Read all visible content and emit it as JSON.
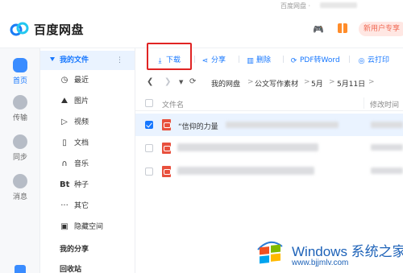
{
  "window": {
    "title": "百度网盘 ·"
  },
  "app": {
    "name": "百度网盘",
    "vip_label": "新用户专享"
  },
  "leftnav": {
    "items": [
      {
        "label": "首页",
        "icon": "cloud-icon",
        "active": true
      },
      {
        "label": "传输",
        "icon": "transfer-icon"
      },
      {
        "label": "同步",
        "icon": "sync-icon"
      },
      {
        "label": "消息",
        "icon": "message-icon"
      }
    ]
  },
  "sidebar": {
    "my_files": "我的文件",
    "more": "⋮",
    "items": [
      {
        "label": "最近",
        "icon": "clock-icon"
      },
      {
        "label": "图片",
        "icon": "image-icon"
      },
      {
        "label": "视频",
        "icon": "video-icon"
      },
      {
        "label": "文档",
        "icon": "document-icon"
      },
      {
        "label": "音乐",
        "icon": "music-icon"
      },
      {
        "label": "种子",
        "icon": "bt-icon",
        "glyph": "Bt"
      },
      {
        "label": "其它",
        "icon": "more-icon",
        "glyph": "···"
      },
      {
        "label": "隐藏空间",
        "icon": "lock-icon"
      }
    ],
    "my_share": "我的分享",
    "recycle": "回收站"
  },
  "toolbar": {
    "download": "下载",
    "share": "分享",
    "delete": "删除",
    "pdf_to_word": "PDF转Word",
    "cloud_print": "云打印"
  },
  "path": {
    "crumbs": [
      "我的网盘",
      ">",
      "公文写作素材",
      ">",
      "5月",
      ">",
      "5月11日",
      ">"
    ]
  },
  "table": {
    "headers": {
      "name": "文件名",
      "modified": "修改时间"
    },
    "rows": [
      {
        "name": "“信仰的力量",
        "selected": true
      },
      {
        "name": "",
        "selected": false
      },
      {
        "name": "",
        "selected": false
      }
    ]
  },
  "watermark": {
    "text": "Windows 系统之家",
    "url": "www.bjjmlv.com"
  },
  "colors": {
    "accent": "#1677ff",
    "highlight": "#e02424",
    "pdf": "#e8503d",
    "selected_row": "#eaf3ff"
  }
}
